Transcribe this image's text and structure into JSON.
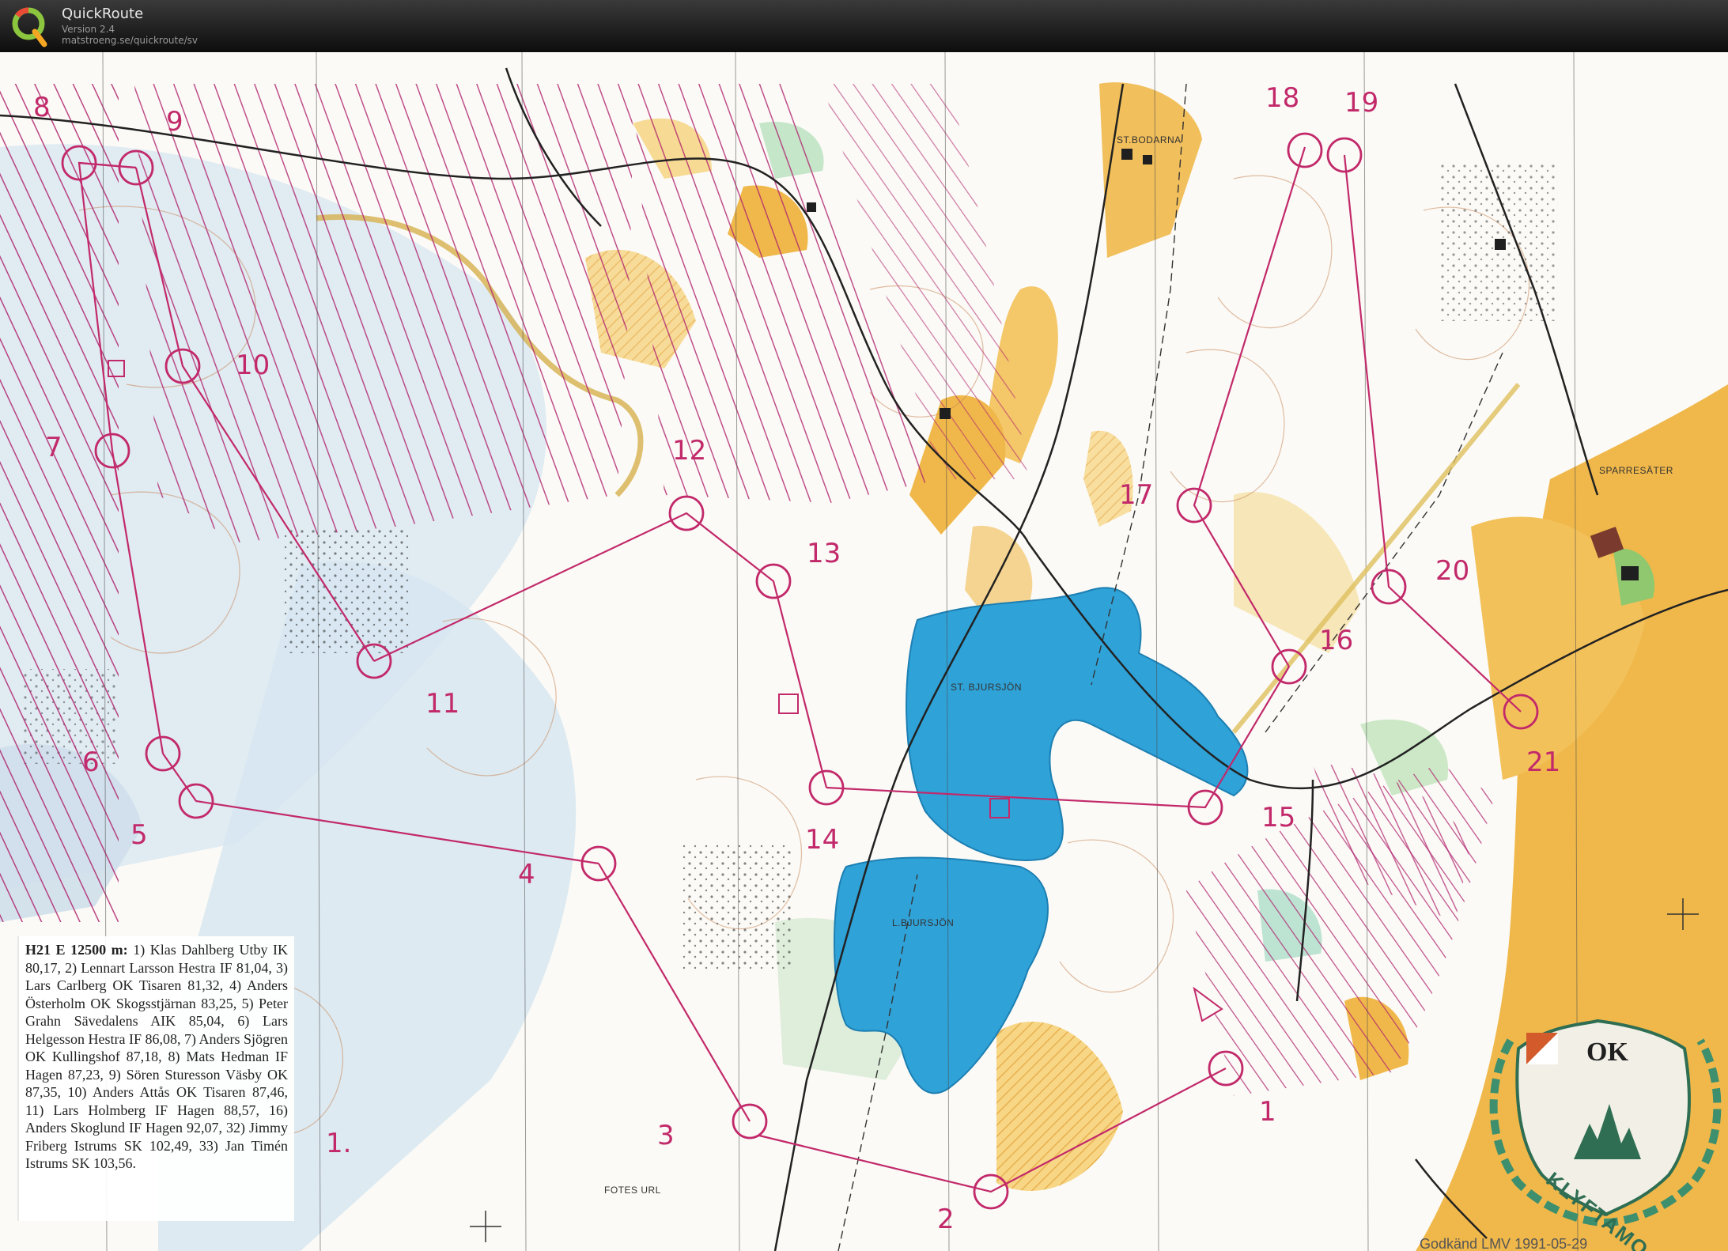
{
  "app": {
    "title": "QuickRoute",
    "version": "Version 2.4",
    "url": "matstroeng.se/quickroute/sv"
  },
  "map": {
    "place_names": {
      "st_bodarna": "ST.BODARNA",
      "sparresater": "SPARRESÄTER",
      "st_bjursjon": "ST. BJURSJÖN",
      "l_bjursjon": "L.BJURSJÖN",
      "fotes_url": "FOTES URL"
    },
    "control_numbers": [
      "1.",
      "1",
      "2",
      "3",
      "4",
      "5",
      "6",
      "7",
      "8",
      "9",
      "10",
      "11",
      "12",
      "13",
      "14",
      "15",
      "16",
      "17",
      "18",
      "19",
      "20",
      "21"
    ],
    "results": {
      "heading": "H21 E 12500 m:",
      "text": "1) Klas Dahlberg Utby IK 80,17, 2) Lennart Larsson Hestra IF 81,04, 3) Lars Carlberg OK Tisaren 81,32, 4) Anders Österholm OK Skogsstjärnan 83,25, 5) Peter Grahn Sävedalens AIK 85,04, 6) Lars Helgesson Hestra IF 86,08, 7) Anders Sjögren OK Kullingshof 87,18, 8) Mats Hedman IF Hagen 87,23, 9) Sören Sturesson Väsby OK 87,35, 10) Anders Attås OK Tisaren 87,46, 11) Lars Holmberg IF Hagen 88,57, 16) Anders Skoglund IF Hagen 92,07, 32) Jimmy Friberg Istrums SK 102,49, 33) Jan Timén Istrums SK 103,56."
    },
    "club_badge": {
      "abbr": "OK",
      "name": "KLYFTAMO"
    },
    "approval": "Godkänd LMV 1991-05-29",
    "colors": {
      "course": "#c2296a",
      "water": "#2fa2d8",
      "open_land": "#f0b84a",
      "marsh_hatch": "#b0246e",
      "rock_blue": "#cfe0ec"
    }
  }
}
